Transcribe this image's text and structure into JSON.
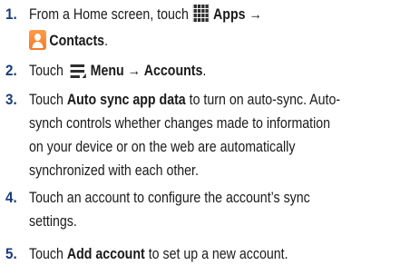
{
  "steps": [
    {
      "number": "1.",
      "lines": [
        {
          "pre": "From a Home screen, touch ",
          "icon": "apps-grid-icon",
          "bold": "Apps",
          "arrow": "→"
        },
        {
          "icon": "contacts-icon",
          "bold": "Contacts",
          "post": "."
        }
      ]
    },
    {
      "number": "2.",
      "lines": [
        {
          "pre": "Touch ",
          "icon": "menu-icon",
          "bold1": "Menu",
          "arrow": "→",
          "bold2": "Accounts",
          "post": "."
        }
      ]
    },
    {
      "number": "3.",
      "lines": [
        {
          "pre": "Touch ",
          "bold": "Auto sync app data",
          "post": " to turn on auto-sync. Auto-"
        },
        {
          "text": "synch controls whether changes made to information"
        },
        {
          "text": "on your device or on the web are automatically"
        },
        {
          "text": "synchronized with each other."
        }
      ]
    },
    {
      "number": "4.",
      "lines": [
        {
          "text": "Touch an account to configure the account’s sync"
        },
        {
          "text": "settings."
        }
      ]
    },
    {
      "number": "5.",
      "lines": [
        {
          "pre": "Touch ",
          "bold": "Add account",
          "post": " to set up a new account."
        }
      ]
    }
  ]
}
